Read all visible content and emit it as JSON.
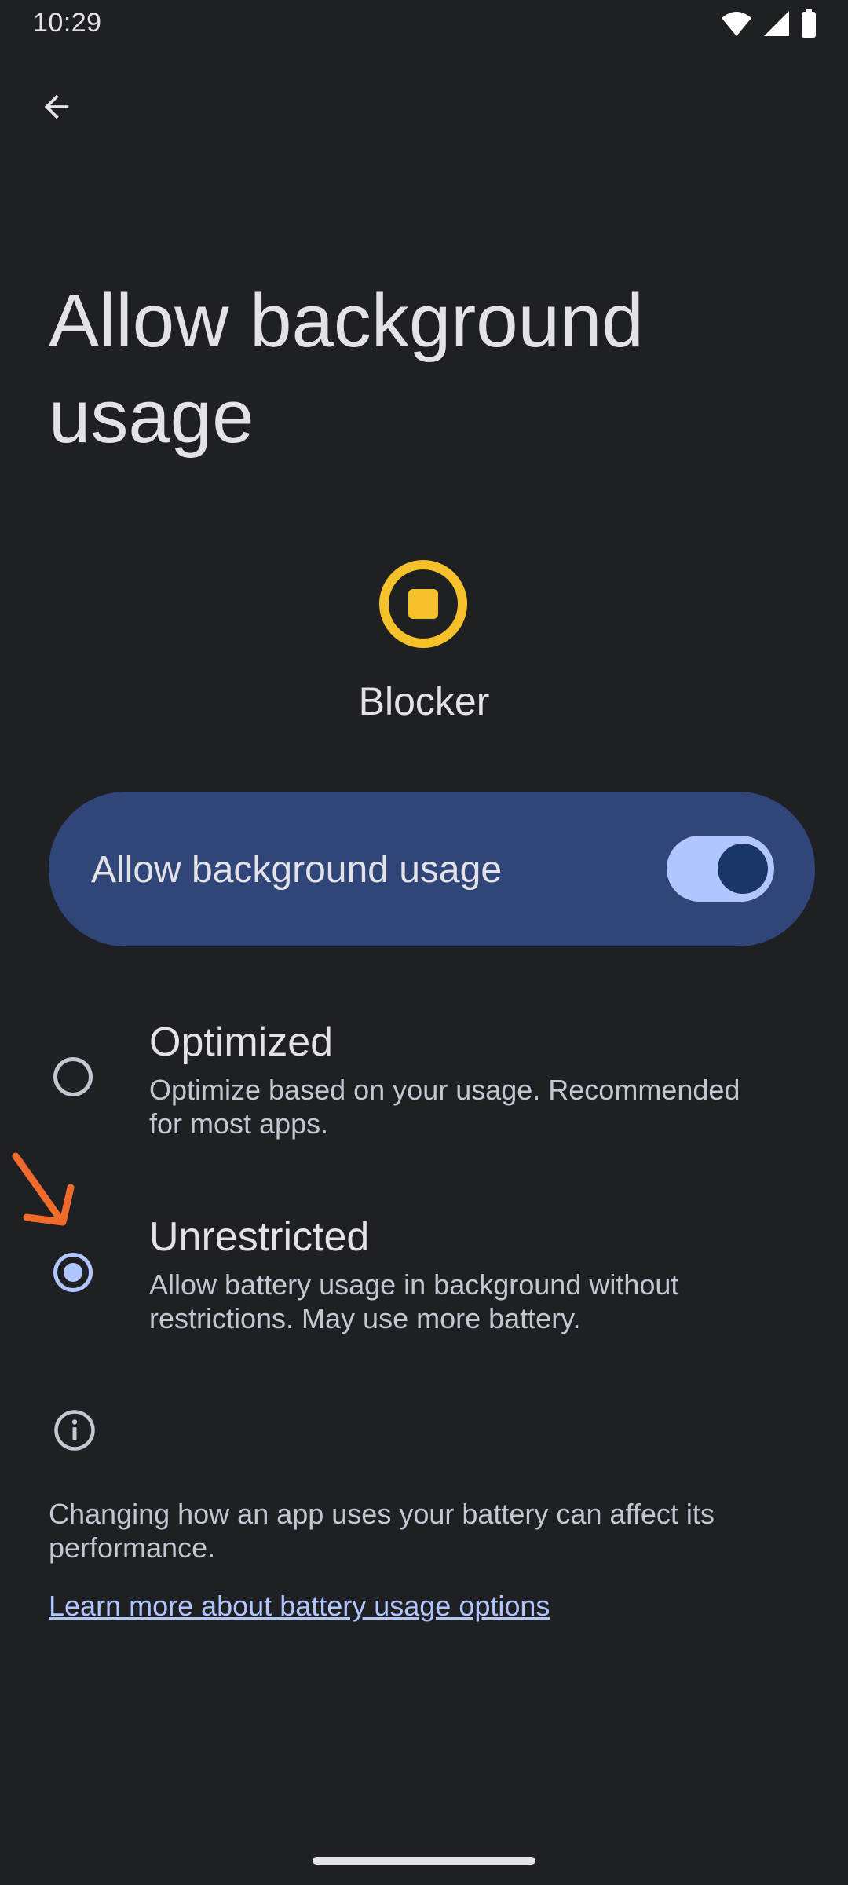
{
  "status_bar": {
    "time": "10:29",
    "icons": [
      "wifi-icon",
      "cellular-signal-icon",
      "battery-icon"
    ]
  },
  "header": {
    "back_icon": "arrow-back-icon",
    "title": "Allow background usage"
  },
  "app": {
    "icon": "blocker-app-icon",
    "name": "Blocker"
  },
  "main_switch": {
    "label": "Allow background usage",
    "checked": true
  },
  "options": [
    {
      "title": "Optimized",
      "summary": "Optimize based on your usage. Recommended for most apps.",
      "selected": false
    },
    {
      "title": "Unrestricted",
      "summary": "Allow battery usage in background without restrictions. May use more battery.",
      "selected": true
    }
  ],
  "footer": {
    "info_icon": "info-icon",
    "text": "Changing how an app uses your battery can affect its performance.",
    "link": "Learn more about battery usage options"
  },
  "colors": {
    "background": "#1f2024",
    "card": "#304578",
    "accent": "#b1c5ff",
    "app_icon": "#f5c12a",
    "annotation": "#f06a2a"
  }
}
